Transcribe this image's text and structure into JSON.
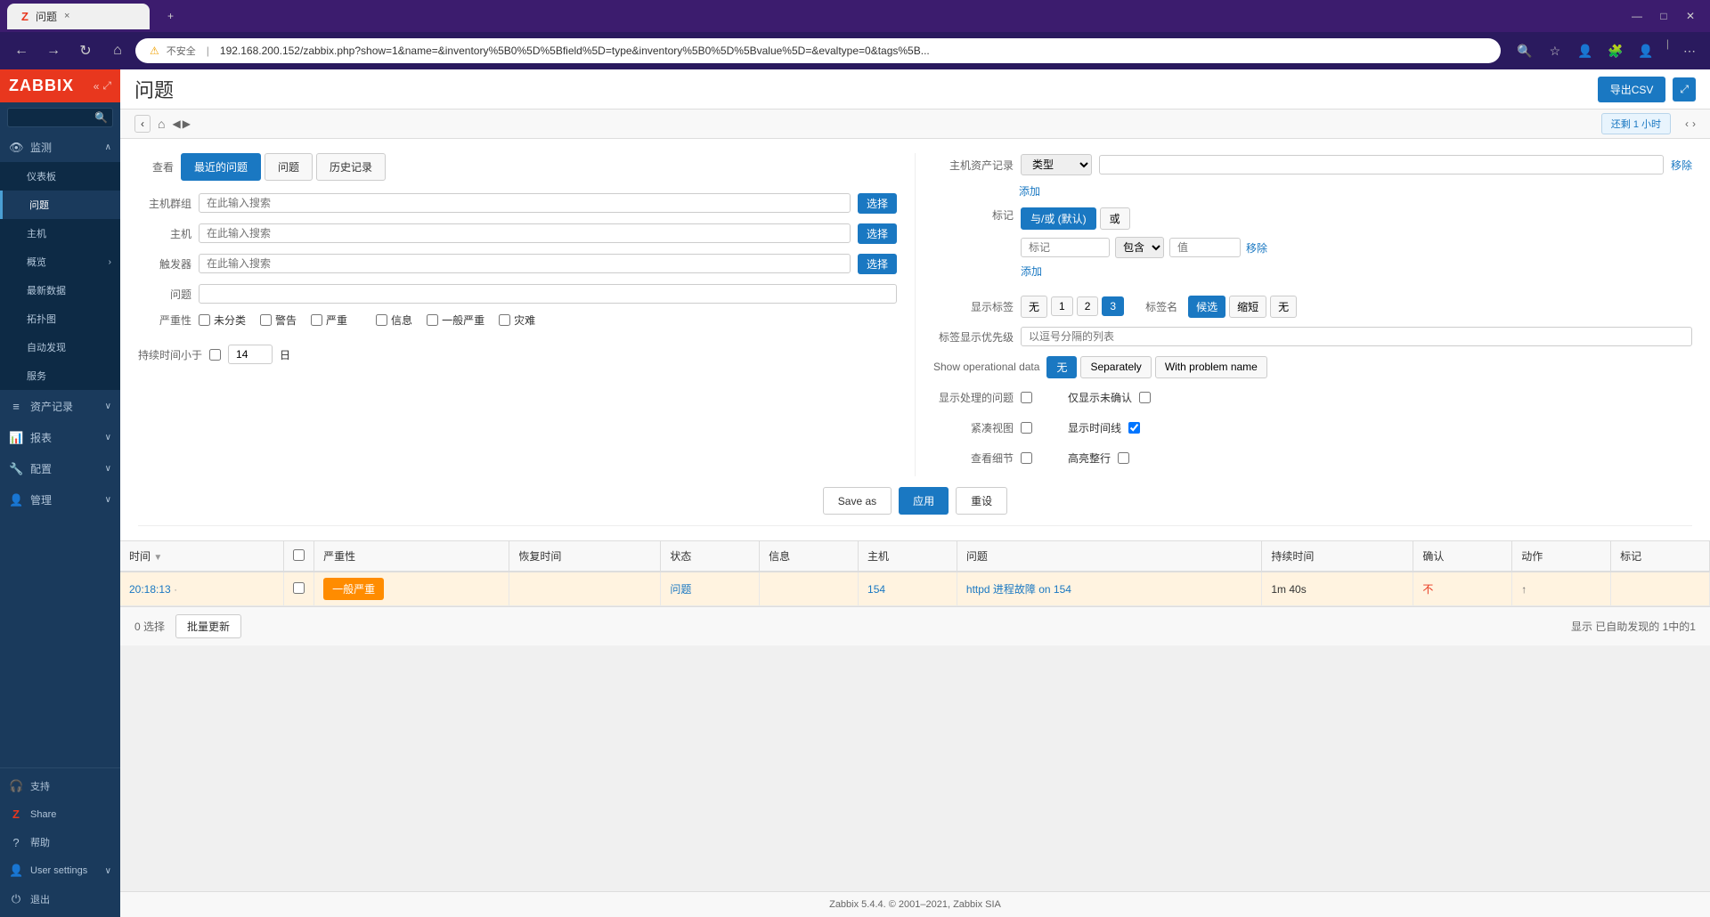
{
  "browser": {
    "tab_title": "问题",
    "tab_icon": "Z",
    "close_tab": "×",
    "new_tab": "+",
    "address": "192.168.200.152/zabbix.php?show=1&name=&inventory%5B0%5D%5Bfield%5D=type&inventory%5B0%5D%5Bvalue%5D=&evaltype=0&tags%5B...",
    "warning_text": "不安全",
    "minimize": "—",
    "maximize": "□",
    "close": "✕",
    "back": "←",
    "forward": "→",
    "reload": "↻",
    "home": "⌂"
  },
  "sidebar": {
    "logo": "ZABBIX",
    "search_placeholder": "",
    "items": [
      {
        "id": "monitor",
        "label": "监测",
        "icon": "👁",
        "has_children": true,
        "expanded": true
      },
      {
        "id": "dashboard",
        "label": "仪表板",
        "icon": "",
        "is_child": true
      },
      {
        "id": "problems",
        "label": "问题",
        "icon": "",
        "is_child": true,
        "active": true
      },
      {
        "id": "hosts",
        "label": "主机",
        "icon": "",
        "is_child": true
      },
      {
        "id": "overview",
        "label": "概览",
        "icon": "",
        "is_child": true,
        "has_children": true
      },
      {
        "id": "latest",
        "label": "最新数据",
        "icon": "",
        "is_child": true
      },
      {
        "id": "topology",
        "label": "拓扑图",
        "icon": "",
        "is_child": true
      },
      {
        "id": "autodiscovery",
        "label": "自动发现",
        "icon": "",
        "is_child": true
      },
      {
        "id": "services",
        "label": "服务",
        "icon": "",
        "is_child": true
      },
      {
        "id": "assets",
        "label": "资产记录",
        "icon": "≡",
        "has_children": true
      },
      {
        "id": "reports",
        "label": "报表",
        "icon": "📊",
        "has_children": true
      },
      {
        "id": "config",
        "label": "配置",
        "icon": "🔧",
        "has_children": true
      },
      {
        "id": "admin",
        "label": "管理",
        "icon": "👤",
        "has_children": true
      }
    ],
    "bottom_items": [
      {
        "id": "support",
        "label": "支持",
        "icon": "🎧"
      },
      {
        "id": "share",
        "label": "Share",
        "icon": "Z"
      },
      {
        "id": "help",
        "label": "帮助",
        "icon": "?"
      },
      {
        "id": "user_settings",
        "label": "User settings",
        "icon": "👤",
        "has_children": true
      },
      {
        "id": "logout",
        "label": "退出",
        "icon": "→"
      }
    ]
  },
  "page": {
    "title": "问题",
    "export_btn": "导出CSV",
    "expand_icon": "⤢"
  },
  "breadcrumb": {
    "back": "‹",
    "forward": "›",
    "home_icon": "⌂",
    "time_badge": "还剩 1 小时",
    "nav_back": "◀",
    "nav_forward": "▶"
  },
  "filter": {
    "viewer_label": "查看",
    "tabs": [
      {
        "id": "recent",
        "label": "最近的问题",
        "active": true
      },
      {
        "id": "problems",
        "label": "问题"
      },
      {
        "id": "history",
        "label": "历史记录"
      }
    ],
    "host_group_label": "主机群组",
    "host_group_placeholder": "在此输入搜索",
    "host_group_btn": "选择",
    "host_label": "主机",
    "host_placeholder": "在此输入搜索",
    "host_btn": "选择",
    "trigger_label": "触发器",
    "trigger_placeholder": "在此输入搜索",
    "trigger_btn": "选择",
    "problem_label": "问题",
    "problem_placeholder": "",
    "severity_label": "严重性",
    "severity_items": [
      {
        "id": "unclassified",
        "label": "未分类",
        "checked": false
      },
      {
        "id": "warning",
        "label": "警告",
        "checked": false
      },
      {
        "id": "severe",
        "label": "严重",
        "checked": false
      },
      {
        "id": "info",
        "label": "信息",
        "checked": false
      },
      {
        "id": "general",
        "label": "一般严重",
        "checked": false
      },
      {
        "id": "disaster",
        "label": "灾难",
        "checked": false
      }
    ],
    "duration_label": "持续时间小于",
    "duration_checked": false,
    "duration_value": "14",
    "duration_unit": "日",
    "host_inventory_label": "主机资产记录",
    "inv_type_options": [
      "类型"
    ],
    "inv_remove": "移除",
    "inv_add": "添加",
    "tags_label": "标记",
    "tag_operator_options": [
      {
        "id": "and_or",
        "label": "与/或 (默认)",
        "active": true
      },
      {
        "id": "or",
        "label": "或"
      }
    ],
    "tag_conditions": [
      "包含"
    ],
    "tag_name_placeholder": "标记",
    "tag_value_placeholder": "值",
    "tag_remove": "移除",
    "tag_add": "添加",
    "show_tags_label": "显示标签",
    "show_tags_options": [
      {
        "id": "none",
        "label": "无"
      },
      {
        "id": "1",
        "label": "1"
      },
      {
        "id": "2",
        "label": "2"
      },
      {
        "id": "3",
        "label": "3",
        "active": true
      }
    ],
    "tag_name_label": "标签名",
    "tag_name_options": [
      {
        "id": "full",
        "label": "候选",
        "active": true
      },
      {
        "id": "abbreviated",
        "label": "缩短"
      },
      {
        "id": "none2",
        "label": "无"
      }
    ],
    "tag_priority_label": "标签显示优先级",
    "tag_priority_placeholder": "以逗号分隔的列表",
    "show_operational_label": "Show operational data",
    "show_operational_options": [
      {
        "id": "none",
        "label": "无",
        "active": true
      },
      {
        "id": "separately",
        "label": "Separately"
      },
      {
        "id": "with_problem",
        "label": "With problem name"
      }
    ],
    "show_handling_label": "显示处理的问题",
    "show_handling_checked": false,
    "only_unconfirmed_label": "仅显示未确认",
    "only_unconfirmed_checked": false,
    "compact_view_label": "紧凑视图",
    "compact_view_checked": false,
    "show_timeline_label": "显示时间线",
    "show_timeline_checked": true,
    "show_tags_view_label": "查看细节",
    "show_tags_view_checked": false,
    "highlight_row_label": "高亮整行",
    "highlight_row_checked": false,
    "save_as_btn": "Save as",
    "apply_btn": "应用",
    "reset_btn": "重设"
  },
  "table": {
    "columns": [
      {
        "id": "time",
        "label": "时间",
        "sortable": true
      },
      {
        "id": "checkbox",
        "label": ""
      },
      {
        "id": "severity",
        "label": "严重性"
      },
      {
        "id": "recovery",
        "label": "恢复时间"
      },
      {
        "id": "status",
        "label": "状态"
      },
      {
        "id": "info",
        "label": "信息"
      },
      {
        "id": "host",
        "label": "主机"
      },
      {
        "id": "problem",
        "label": "问题"
      },
      {
        "id": "duration",
        "label": "持续时间"
      },
      {
        "id": "ack",
        "label": "确认"
      },
      {
        "id": "actions",
        "label": "动作"
      },
      {
        "id": "tags",
        "label": "标记"
      }
    ],
    "rows": [
      {
        "time": "20:18:13",
        "severity": "一般严重",
        "severity_class": "warning",
        "recovery": "",
        "status": "问题",
        "info": "",
        "host": "154",
        "problem": "httpd 进程故障 on 154",
        "duration": "1m 40s",
        "ack": "不",
        "actions": "↑",
        "tags": ""
      }
    ],
    "footer": {
      "selection_label": "0 选择",
      "mass_update_btn": "批量更新",
      "display_info": "显示 已自助发现的 1中的1"
    }
  },
  "footer": {
    "copyright": "Zabbix 5.4.4. © 2001–2021, Zabbix SIA"
  }
}
